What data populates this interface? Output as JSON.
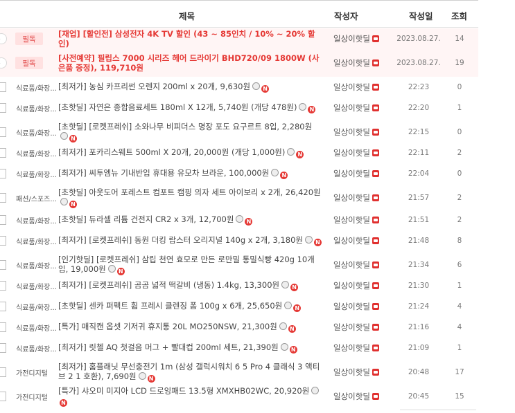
{
  "header": {
    "subject": "제목",
    "author": "작성자",
    "date": "작성일",
    "views": "조회"
  },
  "notices": [
    {
      "badge": "필독",
      "subject": "[재업] [할인전] 삼성전자 4K TV 할인 (43 ~ 85인치 / 10% ~ 20% 할인)",
      "author": "일상이핫딜",
      "date": "2023.08.27.",
      "views": "14"
    },
    {
      "badge": "필독",
      "subject": "[사전예약] 필립스 7000 시리즈 헤어 드라이기 BHD720/09 1800W (사은품 증정), 119,710원",
      "author": "일상이핫딜",
      "date": "2023.08.27.",
      "views": "19"
    }
  ],
  "rows": [
    {
      "category": "식료품/화장...",
      "subject": "[최저가] 농심 카프리썬 오렌지 200ml x 20개, 9,630원",
      "author": "일상이핫딜",
      "date": "22:23",
      "views": "0"
    },
    {
      "category": "식료품/화장...",
      "subject": "[초핫딜] 자연은 종합음료세트 180ml X 12개, 5,740원 (개당 478원)",
      "author": "일상이핫딜",
      "date": "22:20",
      "views": "1"
    },
    {
      "category": "식료품/화장...",
      "subject": "[초핫딜] [로켓프레쉬] 소와나무 비피더스 명장 포도 요구르트 8입, 2,280원",
      "author": "일상이핫딜",
      "date": "22:15",
      "views": "0"
    },
    {
      "category": "식료품/화장...",
      "subject": "[최저가] 포카리스웨트 500ml X 20개, 20,000원 (개당 1,000원)",
      "author": "일상이핫딜",
      "date": "22:11",
      "views": "2"
    },
    {
      "category": "식료품/화장...",
      "subject": "[최저가] 씨투엠뉴 기내반입 휴대용 유모차 브라운, 100,000원",
      "author": "일상이핫딜",
      "date": "22:04",
      "views": "0"
    },
    {
      "category": "패션/스포즈...",
      "subject": "[초핫딜] 아웃도어 포레스트 컴포트 캠핑 의자 세트 아이보리 x 2개, 26,420원",
      "author": "일상이핫딜",
      "date": "21:57",
      "views": "2"
    },
    {
      "category": "식료품/화장...",
      "subject": "[초핫딜] 듀라셀 리튬 건전지 CR2 x 3개, 12,700원",
      "author": "일상이핫딜",
      "date": "21:51",
      "views": "2"
    },
    {
      "category": "식료품/화장...",
      "subject": "[최저가] [로켓프레쉬] 동원 더킹 랍스터 오리지널 140g x 2개, 3,180원",
      "author": "일상이핫딜",
      "date": "21:48",
      "views": "8"
    },
    {
      "category": "식료품/화장...",
      "subject": "[인기핫딜] [로켓프레쉬] 삼립 천연 효모로 만든 로만밀 통밀식빵 420g 10개입, 19,000원",
      "author": "일상이핫딜",
      "date": "21:34",
      "views": "6"
    },
    {
      "category": "식료품/화장...",
      "subject": "[최저가] [로켓프레쉬] 곰곰 넓적 떡갈비 (냉동) 1.4kg, 13,300원",
      "author": "일상이핫딜",
      "date": "21:30",
      "views": "1"
    },
    {
      "category": "식료품/화장...",
      "subject": "[초핫딜] 센카 퍼펙트 휩 프레시 클렌징 폼 100g x 6개, 25,650원",
      "author": "일상이핫딜",
      "date": "21:24",
      "views": "4"
    },
    {
      "category": "식료품/화장...",
      "subject": "[특가] 매직캔 옵셋 기저귀 휴지통 20L MO250NSW, 21,300원",
      "author": "일상이핫딜",
      "date": "21:16",
      "views": "4"
    },
    {
      "category": "식료품/화장...",
      "subject": "[최저가] 릿첼 AQ 첫걸음 머그 + 빨대컵 200ml 세트, 21,390원",
      "author": "일상이핫딜",
      "date": "21:09",
      "views": "1"
    },
    {
      "category": "가전디지털",
      "subject": "[최저가] 홈플래닛 무선충전기 1m (삼성 갤럭시워치 6 5 Pro 4 클래식 3 액티브 2 1 호환), 7,690원",
      "author": "일상이핫딜",
      "date": "20:48",
      "views": "17"
    },
    {
      "category": "가전디지털",
      "subject": "[특가] 샤오미 미지아 LCD 드로잉패드 13.5형 XMXHB02WC, 20,920원",
      "author": "일상이핫딜",
      "date": "20:45",
      "views": "15"
    }
  ]
}
